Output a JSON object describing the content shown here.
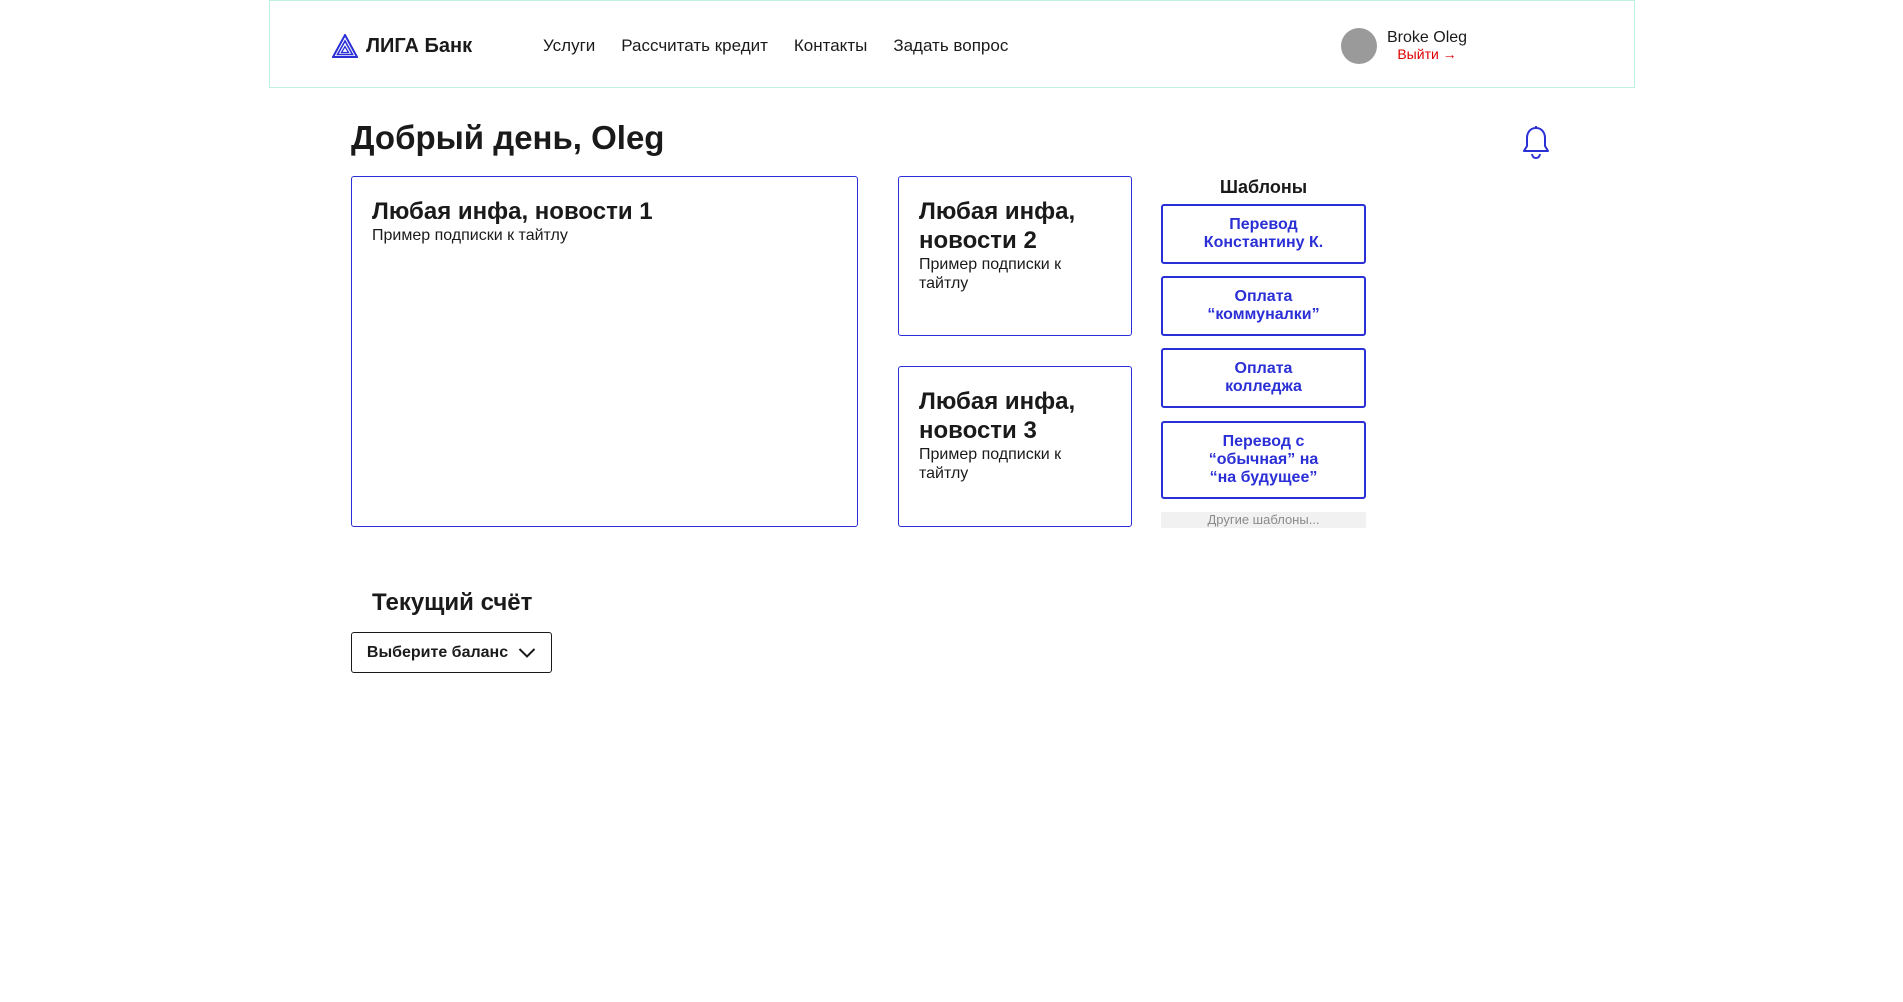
{
  "header": {
    "logo_text": "ЛИГА Банк",
    "nav": [
      {
        "label": "Услуги"
      },
      {
        "label": "Рассчитать кредит"
      },
      {
        "label": "Контакты"
      },
      {
        "label": "Задать вопрос"
      }
    ],
    "user": {
      "name": "Broke Oleg",
      "logout_label": "Выйти →"
    }
  },
  "greeting": "Добрый день, Oleg",
  "news": [
    {
      "title": "Любая инфа, новости 1",
      "subtitle": "Пример подписки к тайтлу"
    },
    {
      "title": "Любая инфа, новости 2",
      "subtitle": "Пример подписки к тайтлу"
    },
    {
      "title": "Любая инфа, новости 3",
      "subtitle": "Пример подписки к тайтлу"
    }
  ],
  "templates": {
    "title": "Шаблоны",
    "items": [
      {
        "label": "Перевод\nКонстантину К."
      },
      {
        "label": "Оплата\n“коммуналки”"
      },
      {
        "label": "Оплата\nколледжа"
      },
      {
        "label": "Перевод с\n“обычная” на\n“на будущее”"
      }
    ],
    "more_label": "Другие шаблоны..."
  },
  "account": {
    "title": "Текущий счёт",
    "select_label": "Выберите баланс"
  },
  "colors": {
    "accent": "#2b2fd6",
    "logout": "#e00000",
    "header_border": "#bff0e2",
    "avatar": "#9a9a9a"
  },
  "icons": {
    "logo": "triangle-logo-icon",
    "bell": "bell-icon",
    "dropdown": "chevron-down-icon"
  }
}
